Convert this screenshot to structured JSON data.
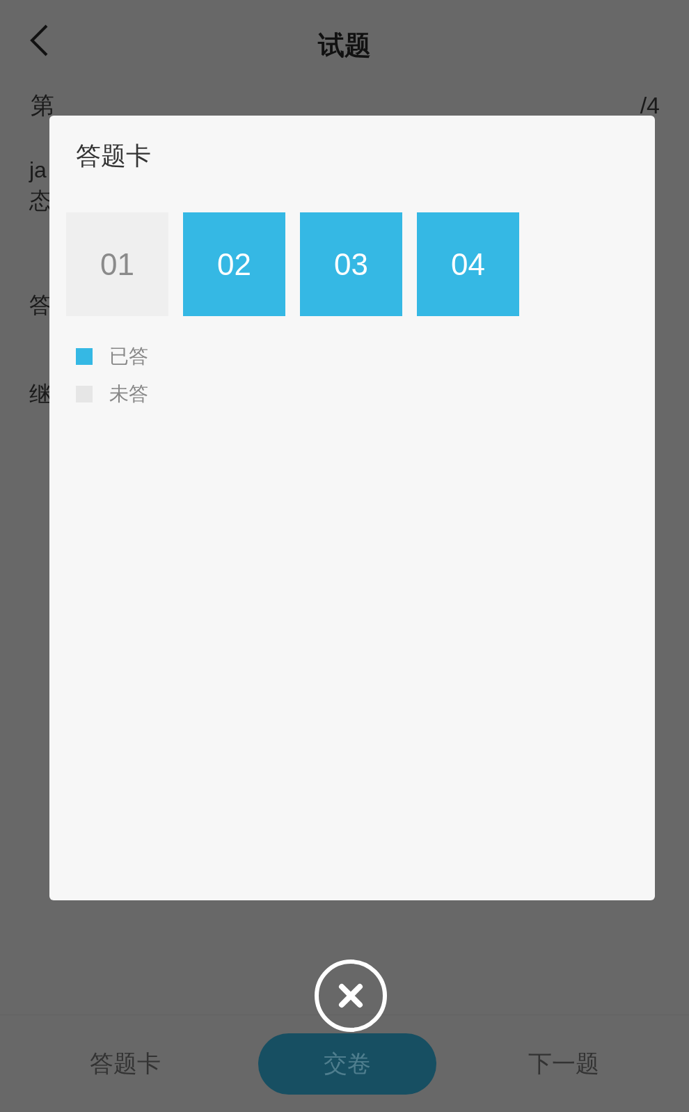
{
  "header": {
    "title": "试题"
  },
  "background_fragments": {
    "question_label": "第",
    "counter": "/4",
    "lines": [
      "ja",
      "态",
      "答",
      "继"
    ]
  },
  "answer_card": {
    "title": "答题卡",
    "items": [
      {
        "number": "01",
        "answered": false
      },
      {
        "number": "02",
        "answered": true
      },
      {
        "number": "03",
        "answered": true
      },
      {
        "number": "04",
        "answered": true
      }
    ],
    "legend": [
      {
        "kind": "answered",
        "label": "已答"
      },
      {
        "kind": "unanswered",
        "label": "未答"
      }
    ]
  },
  "bottom_bar": {
    "answer_card": "答题卡",
    "submit": "交卷",
    "next": "下一题"
  }
}
